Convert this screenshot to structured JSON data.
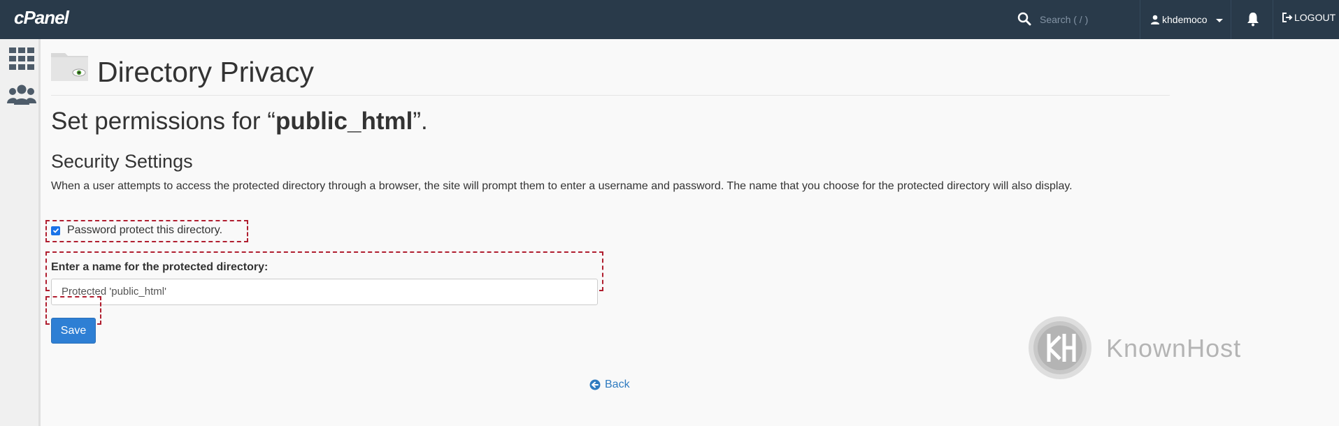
{
  "topbar": {
    "logo": "cPanel",
    "search_placeholder": "Search ( / )",
    "username": "khdemoco",
    "logout_label": "LOGOUT"
  },
  "sidebar": {
    "icons": [
      "apps-grid-icon",
      "users-icon"
    ]
  },
  "page": {
    "title": "Directory Privacy",
    "perm_prefix": "Set permissions for “",
    "perm_dir": "public_html",
    "perm_suffix": "”.",
    "section_title": "Security Settings",
    "section_desc": "When a user attempts to access the protected directory through a browser, the site will prompt them to enter a username and password. The name that you choose for the protected directory will also display.",
    "checkbox_label": "Password protect this directory.",
    "checkbox_checked": true,
    "name_label": "Enter a name for the protected directory:",
    "name_value": "Protected 'public_html'",
    "save_label": "Save",
    "back_label": "Back"
  },
  "watermark": {
    "brand": "KnownHost"
  },
  "colors": {
    "topbar": "#293a4a",
    "accent": "#2e7fd4",
    "highlight_dash": "#b01e2f"
  }
}
